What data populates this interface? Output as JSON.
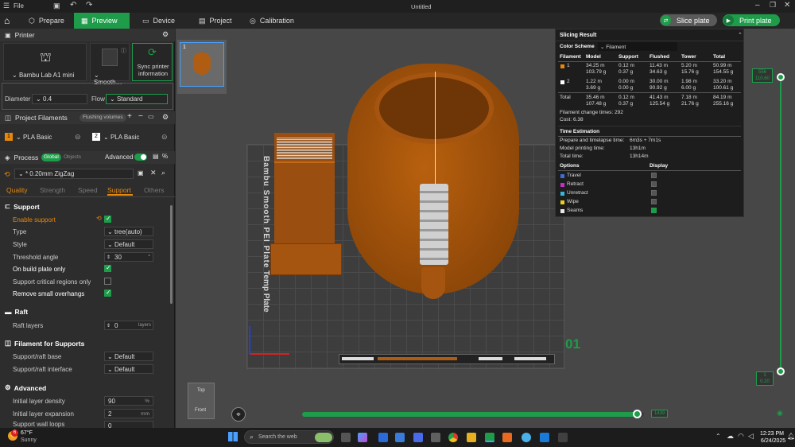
{
  "titlebar": {
    "menu": "File",
    "title": "Untitled"
  },
  "nav": {
    "prepare": "Prepare",
    "preview": "Preview",
    "device": "Device",
    "project": "Project",
    "calibration": "Calibration",
    "slice": "Slice plate",
    "print": "Print plate"
  },
  "printer": {
    "header": "Printer",
    "name": "Bambu Lab A1 mini",
    "plate": "Smooth…",
    "sync": "Sync printer information",
    "diameter_label": "Diameter",
    "diameter": "0.4",
    "flow_label": "Flow",
    "flow": "Standard"
  },
  "filaments": {
    "header": "Project Filaments",
    "flushing": "Flushing volumes",
    "items": [
      {
        "num": "1",
        "name": "PLA Basic",
        "color": "#e8870a"
      },
      {
        "num": "2",
        "name": "PLA Basic",
        "color": "#ffffff"
      }
    ]
  },
  "process": {
    "header": "Process",
    "global": "Global",
    "objects": "Objects",
    "advanced": "Advanced",
    "preset": "* 0.20mm ZigZag",
    "tabs": [
      "Quality",
      "Strength",
      "Speed",
      "Support",
      "Others"
    ]
  },
  "support": {
    "header": "Support",
    "enable": "Enable support",
    "type_label": "Type",
    "type": "tree(auto)",
    "style_label": "Style",
    "style": "Default",
    "threshold_label": "Threshold angle",
    "threshold": "30",
    "build_plate": "On build plate only",
    "critical": "Support critical regions only",
    "remove_small": "Remove small overhangs"
  },
  "raft": {
    "header": "Raft",
    "layers_label": "Raft layers",
    "layers": "0",
    "layers_unit": "layers"
  },
  "filament_supports": {
    "header": "Filament for Supports",
    "base_label": "Support/raft base",
    "base": "Default",
    "interface_label": "Support/raft interface",
    "interface": "Default"
  },
  "advanced": {
    "header": "Advanced",
    "density_label": "Initial layer density",
    "density": "90",
    "density_unit": "%",
    "expansion_label": "Initial layer expansion",
    "expansion": "2",
    "expansion_unit": "mm",
    "wall_label": "Support wall loops",
    "wall": "0"
  },
  "viewport": {
    "plate_num": "1",
    "plate_label": "01",
    "plate_text": "Bambu Smooth PEI Plate",
    "temp_plate": "Temp Plate",
    "cube_top": "Top",
    "cube_front": "Front",
    "layer_top": "556\n110.60",
    "layer_bottom": "1\n0.20",
    "progress": "1439",
    "progress_fraction": 0.98
  },
  "slicing": {
    "title": "Slicing Result",
    "color_scheme": "Color Scheme",
    "scheme": "Filament",
    "headers": [
      "Filament",
      "Model",
      "Support",
      "Flushed",
      "Tower",
      "Total"
    ],
    "rows": [
      {
        "id": "1",
        "color": "#e8870a",
        "model": "34.25 m\n103.79 g",
        "support": "0.12 m\n0.37 g",
        "flushed": "11.43 m\n34.63 g",
        "tower": "5.20 m\n15.76 g",
        "total": "50.99 m\n154.55 g"
      },
      {
        "id": "2",
        "color": "#ffffff",
        "model": "1.22 m\n3.69 g",
        "support": "0.00 m\n0.00 g",
        "flushed": "30.00 m\n90.92 g",
        "tower": "1.98 m\n6.00 g",
        "total": "33.20 m\n100.61 g"
      }
    ],
    "total_row": {
      "label": "Total",
      "model": "35.46 m\n107.48 g",
      "support": "0.12 m\n0.37 g",
      "flushed": "41.43 m\n125.54 g",
      "tower": "7.18 m\n21.76 g",
      "total": "84.19 m\n255.16 g"
    },
    "change_times": "Filament change times:  292",
    "cost": "Cost:  6.38",
    "time_header": "Time Estimation",
    "times": [
      {
        "label": "Prepare and timelapse time:",
        "value": "6m3s + 7m1s"
      },
      {
        "label": "Model printing time:",
        "value": "13h1m"
      },
      {
        "label": "Total time:",
        "value": "13h14m"
      }
    ],
    "options_header": "Options",
    "display_header": "Display",
    "options": [
      {
        "label": "Travel",
        "color": "#3a6fd8"
      },
      {
        "label": "Retract",
        "color": "#c42ec4"
      },
      {
        "label": "Unretract",
        "color": "#38b6e0"
      },
      {
        "label": "Wipe",
        "color": "#e8d21a"
      },
      {
        "label": "Seams",
        "color": "#e8e8e8"
      }
    ]
  },
  "taskbar": {
    "temp": "67°F",
    "weather": "Sunny",
    "search": "Search the web",
    "time": "12:23 PM",
    "date": "6/24/2025",
    "badge": "6"
  }
}
